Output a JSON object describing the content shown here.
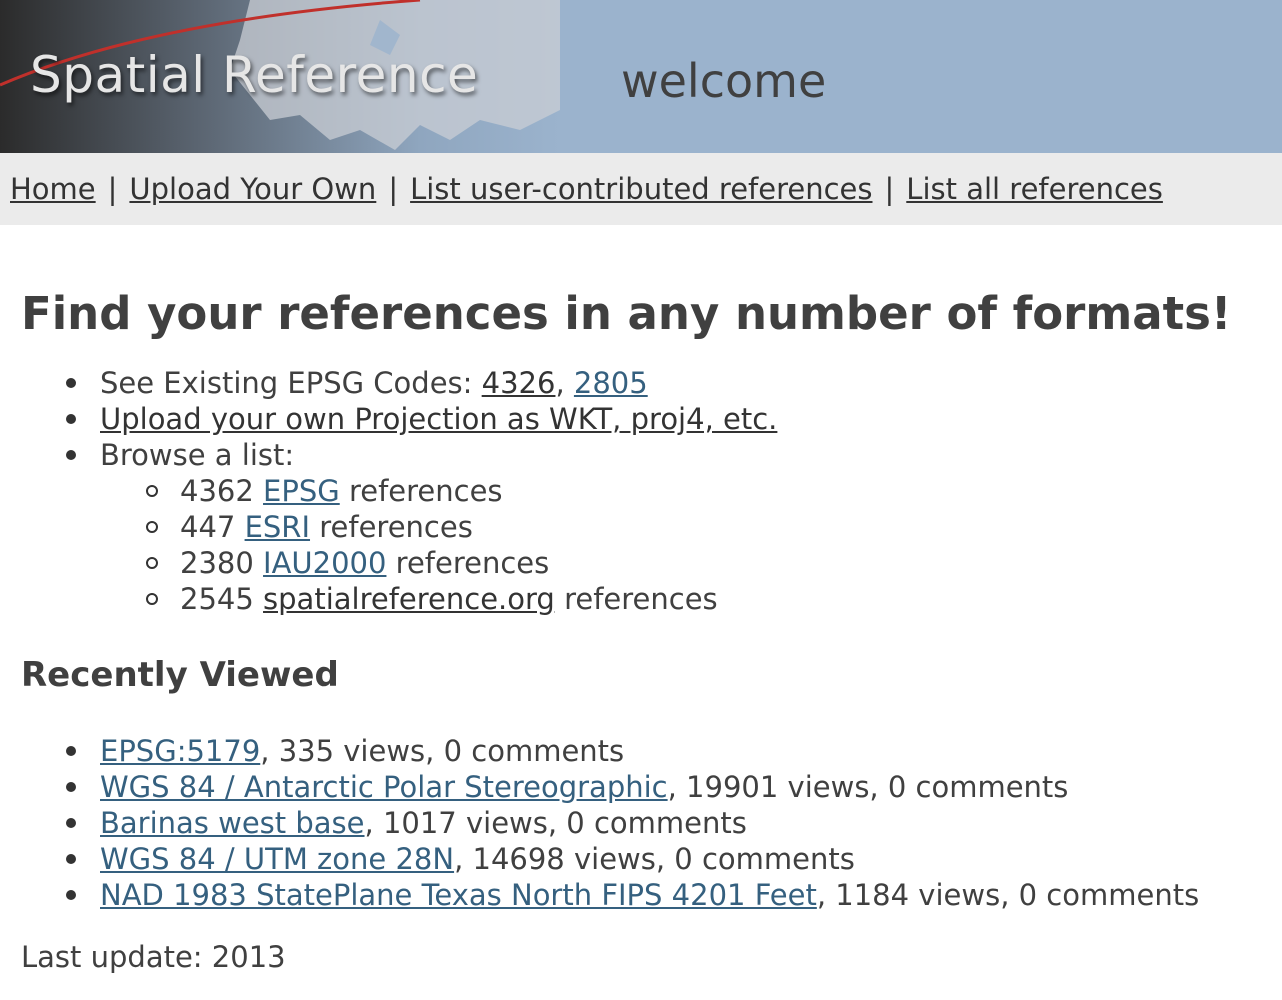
{
  "banner": {
    "logo_text": "Spatial Reference",
    "welcome": "welcome"
  },
  "nav": {
    "items": [
      "Home",
      "Upload Your Own",
      "List user-contributed references",
      "List all references"
    ],
    "separator": "|"
  },
  "main": {
    "headline": "Find your references in any number of formats!",
    "existing": {
      "prefix": "See Existing EPSG Codes: ",
      "codes": [
        "4326",
        "2805"
      ],
      "comma": ", "
    },
    "upload_link": "Upload your own Projection as WKT, proj4, etc.",
    "browse_label": "Browse a list:",
    "browse": [
      {
        "count": "4362",
        "link": "EPSG",
        "suffix": "references"
      },
      {
        "count": "447",
        "link": "ESRI",
        "suffix": "references"
      },
      {
        "count": "2380",
        "link": "IAU2000",
        "suffix": "references"
      },
      {
        "count": "2545",
        "link": "spatialreference.org",
        "suffix": "references"
      }
    ]
  },
  "recent": {
    "heading": "Recently Viewed",
    "items": [
      {
        "link": "EPSG:5179",
        "stats": ", 335 views, 0 comments"
      },
      {
        "link": "WGS 84 / Antarctic Polar Stereographic",
        "stats": ", 19901 views, 0 comments"
      },
      {
        "link": "Barinas west base",
        "stats": ", 1017 views, 0 comments"
      },
      {
        "link": "WGS 84 / UTM zone 28N",
        "stats": ", 14698 views, 0 comments"
      },
      {
        "link": "NAD 1983 StatePlane Texas North FIPS 4201 Feet",
        "stats": ", 1184 views, 0 comments"
      }
    ]
  },
  "footer": {
    "text": "Last update: 2013"
  },
  "colors": {
    "banner_bg": "#9bb3cd",
    "nav_bg": "#ebebeb",
    "link": "#35607f",
    "text": "#404040"
  }
}
